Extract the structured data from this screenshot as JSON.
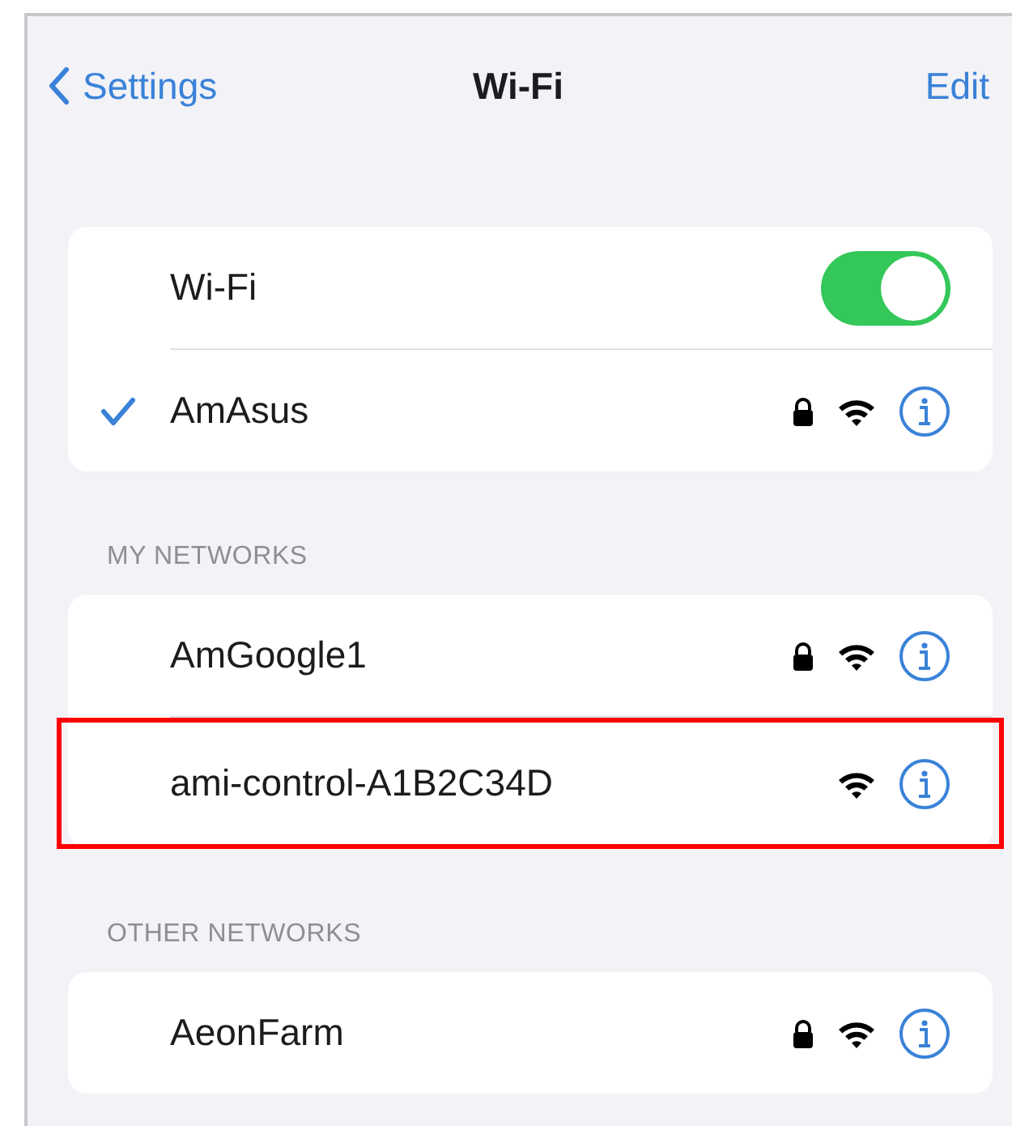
{
  "nav": {
    "back": "Settings",
    "title": "Wi-Fi",
    "action": "Edit"
  },
  "groups": [
    {
      "rows": [
        {
          "kind": "toggle",
          "label": "Wi-Fi",
          "on": true
        },
        {
          "kind": "network",
          "name": "AmAsus",
          "connected": true,
          "secured": true,
          "highlighted": false
        }
      ]
    },
    {
      "header": "MY NETWORKS",
      "rows": [
        {
          "kind": "network",
          "name": "AmGoogle1",
          "connected": false,
          "secured": true,
          "highlighted": false
        },
        {
          "kind": "network",
          "name": "ami-control-A1B2C34D",
          "connected": false,
          "secured": false,
          "highlighted": true
        }
      ]
    },
    {
      "header": "OTHER NETWORKS",
      "rows": [
        {
          "kind": "network",
          "name": "AeonFarm",
          "connected": false,
          "secured": true,
          "highlighted": false
        }
      ]
    }
  ]
}
